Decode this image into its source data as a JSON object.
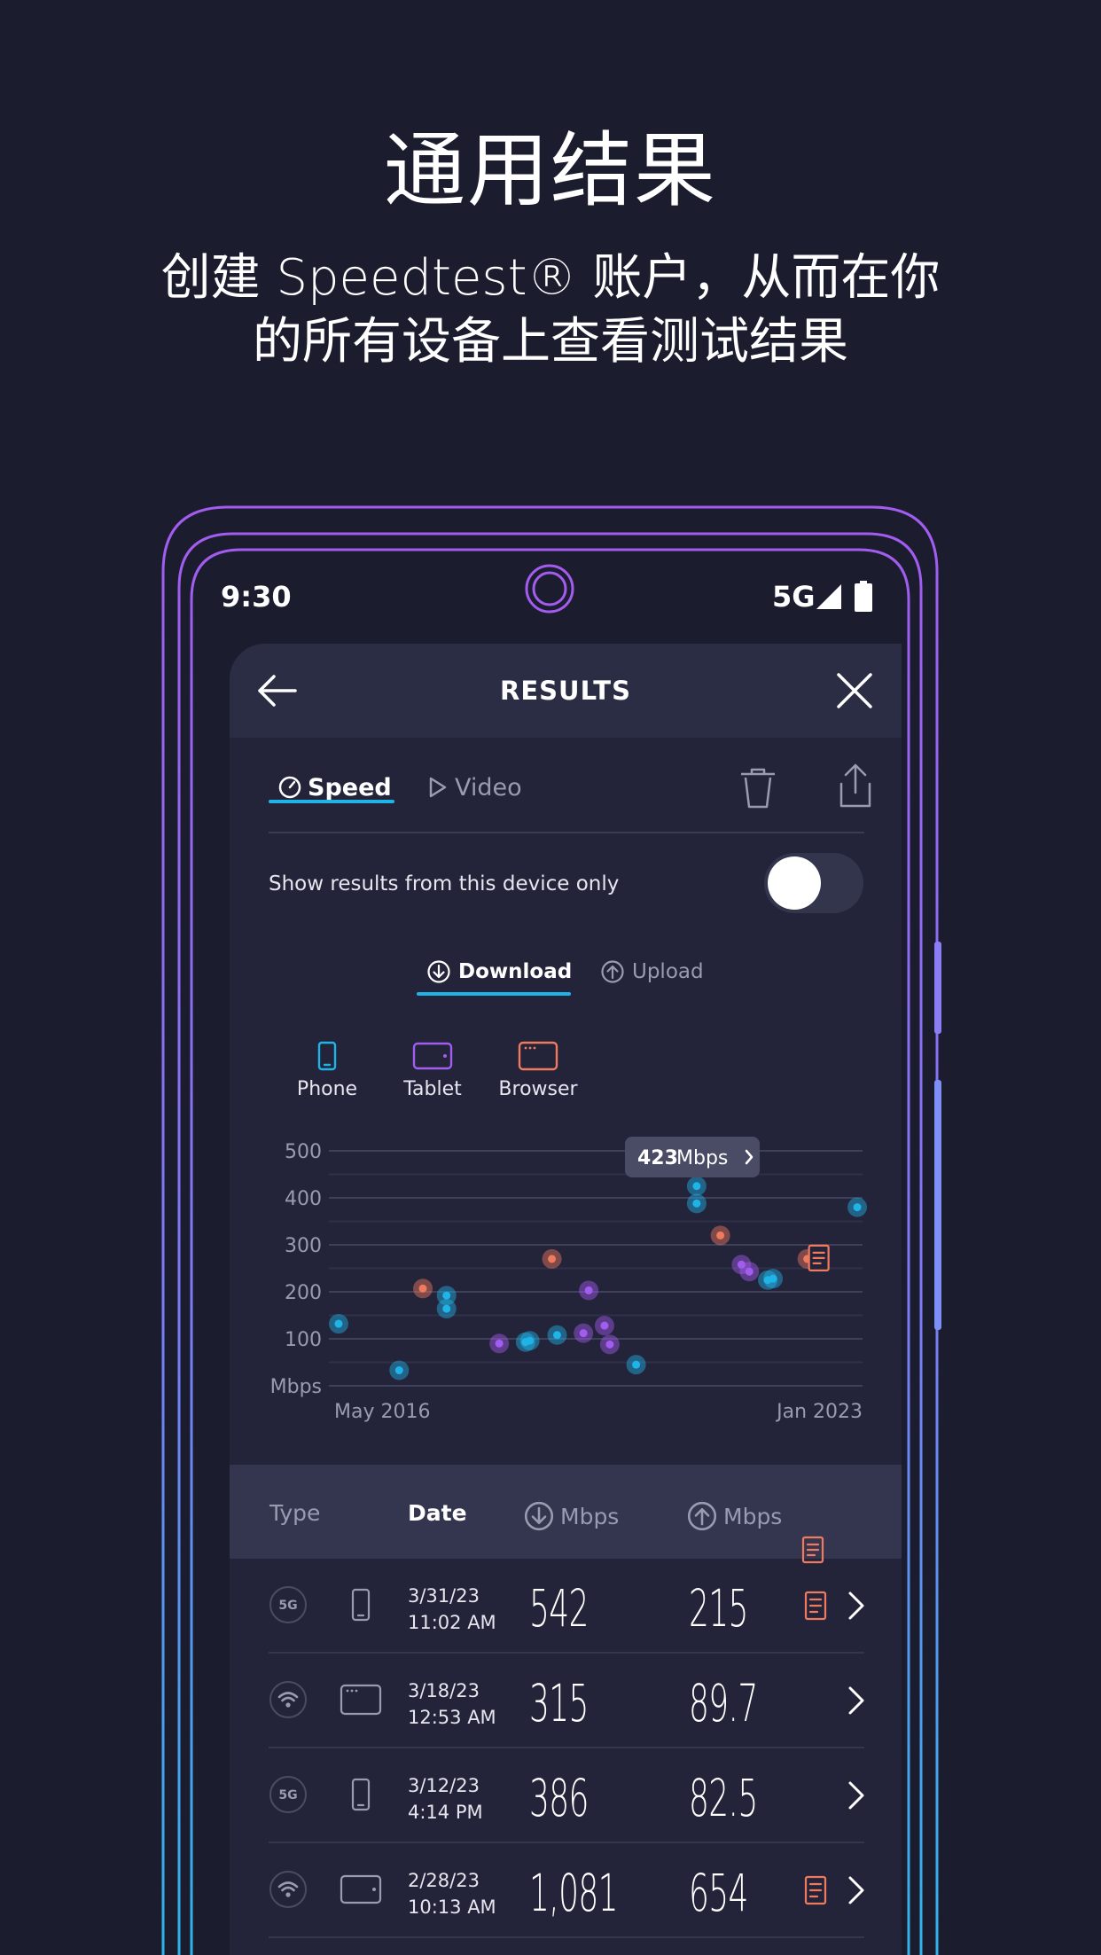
{
  "promo": {
    "headline": "通用结果",
    "subline_1": "创建 Speedtest® 账户，从而在你",
    "subline_2": "的所有设备上查看测试结果"
  },
  "status_bar": {
    "time": "9:30",
    "network": "5G"
  },
  "header": {
    "title": "RESULTS"
  },
  "tabs": [
    {
      "label": "Speed",
      "active": true
    },
    {
      "label": "Video",
      "active": false
    }
  ],
  "filter": {
    "label": "Show results from this device only",
    "enabled": false
  },
  "direction_tabs": [
    {
      "label": "Download",
      "active": true
    },
    {
      "label": "Upload",
      "active": false
    }
  ],
  "legend": [
    {
      "label": "Phone",
      "color": "#1fb4e8"
    },
    {
      "label": "Tablet",
      "color": "#a35cf0"
    },
    {
      "label": "Browser",
      "color": "#f07a5e"
    }
  ],
  "tooltip": {
    "value": "423",
    "unit": "Mbps"
  },
  "chart_data": {
    "type": "scatter",
    "y_tick_labels": [
      "500",
      "400",
      "300",
      "200",
      "100",
      "Mbps"
    ],
    "y_ticks": [
      500,
      400,
      300,
      200,
      100,
      0
    ],
    "ylim": [
      0,
      500
    ],
    "x_start_label": "May 2016",
    "x_end_label": "Jan 2023",
    "xlim": [
      0,
      100
    ],
    "grid": true,
    "series": [
      {
        "name": "Phone",
        "color": "#1fb4e8",
        "points": [
          [
            0.5,
            132
          ],
          [
            12,
            33
          ],
          [
            21,
            192
          ],
          [
            21,
            164
          ],
          [
            36,
            93
          ],
          [
            36.8,
            96
          ],
          [
            42,
            108
          ],
          [
            57,
            45
          ],
          [
            68.5,
            425
          ],
          [
            68.5,
            388
          ],
          [
            82,
            225
          ],
          [
            83,
            228
          ],
          [
            99,
            380
          ]
        ]
      },
      {
        "name": "Tablet",
        "color": "#a35cf0",
        "points": [
          [
            31,
            90
          ],
          [
            48,
            203
          ],
          [
            47,
            112
          ],
          [
            51,
            128
          ],
          [
            52,
            88
          ],
          [
            77,
            258
          ],
          [
            78.5,
            243
          ]
        ]
      },
      {
        "name": "Browser",
        "color": "#f07a5e",
        "points": [
          [
            16.5,
            207
          ],
          [
            41,
            270
          ],
          [
            73,
            320
          ],
          [
            89.5,
            270
          ]
        ]
      }
    ]
  },
  "table": {
    "headers": {
      "type": "Type",
      "date": "Date",
      "download": "Mbps",
      "upload": "Mbps"
    },
    "rows": [
      {
        "conn": "5G",
        "device": "phone",
        "date": "3/31/23",
        "time": "11:02 AM",
        "download": "542",
        "upload": "215",
        "note": true
      },
      {
        "conn": "wifi",
        "device": "browser",
        "date": "3/18/23",
        "time": "12:53 AM",
        "download": "315",
        "upload": "89.7",
        "note": false
      },
      {
        "conn": "5G",
        "device": "phone",
        "date": "3/12/23",
        "time": "4:14 PM",
        "download": "386",
        "upload": "82.5",
        "note": false
      },
      {
        "conn": "wifi",
        "device": "tablet",
        "date": "2/28/23",
        "time": "10:13 AM",
        "download": "1,081",
        "upload": "654",
        "note": true
      }
    ]
  }
}
